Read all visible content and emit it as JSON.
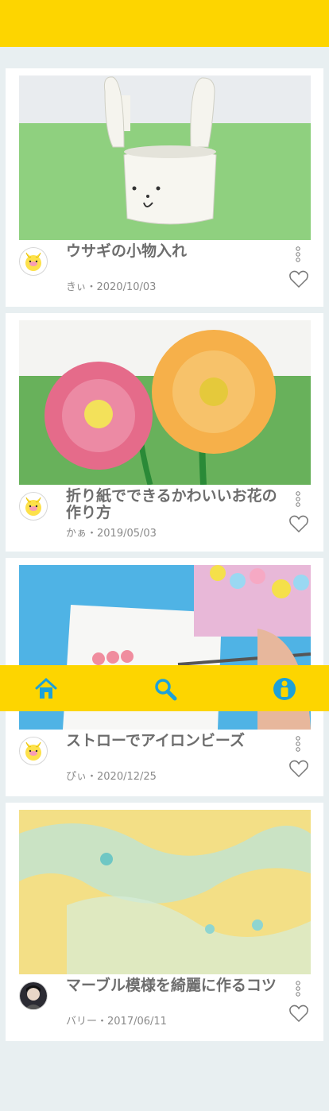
{
  "posts": [
    {
      "title": "ウサギの小物入れ",
      "author": "きぃ",
      "date": "2020/10/03",
      "meta": "きぃ・2020/10/03",
      "thumb_icon": "rabbit-paper-cup-photo",
      "avatar_icon": "chick-avatar-icon"
    },
    {
      "title": "折り紙でできるかわいいお花の作り方",
      "author": "かぁ",
      "date": "2019/05/03",
      "meta": "かぁ・2019/05/03",
      "thumb_icon": "origami-flowers-photo",
      "avatar_icon": "chick-avatar-icon"
    },
    {
      "title": "ストローでアイロンビーズ",
      "author": "ぴぃ",
      "date": "2020/12/25",
      "meta": "ぴぃ・2020/12/25",
      "thumb_icon": "straw-beads-photo",
      "avatar_icon": "chick-avatar-icon"
    },
    {
      "title": "マーブル模様を綺麗に作るコツ",
      "author": "バリー",
      "date": "2017/06/11",
      "meta": "バリー・2017/06/11",
      "thumb_icon": "marble-pattern-photo",
      "avatar_icon": "character-avatar-icon"
    }
  ],
  "nav": {
    "items": [
      "home-icon",
      "search-icon",
      "user-icon"
    ]
  },
  "colors": {
    "accent": "#fdd500",
    "nav_icon": "#1da1d8",
    "background": "#e8eff1",
    "card": "#ffffff",
    "title_text": "#6d6d6d"
  }
}
